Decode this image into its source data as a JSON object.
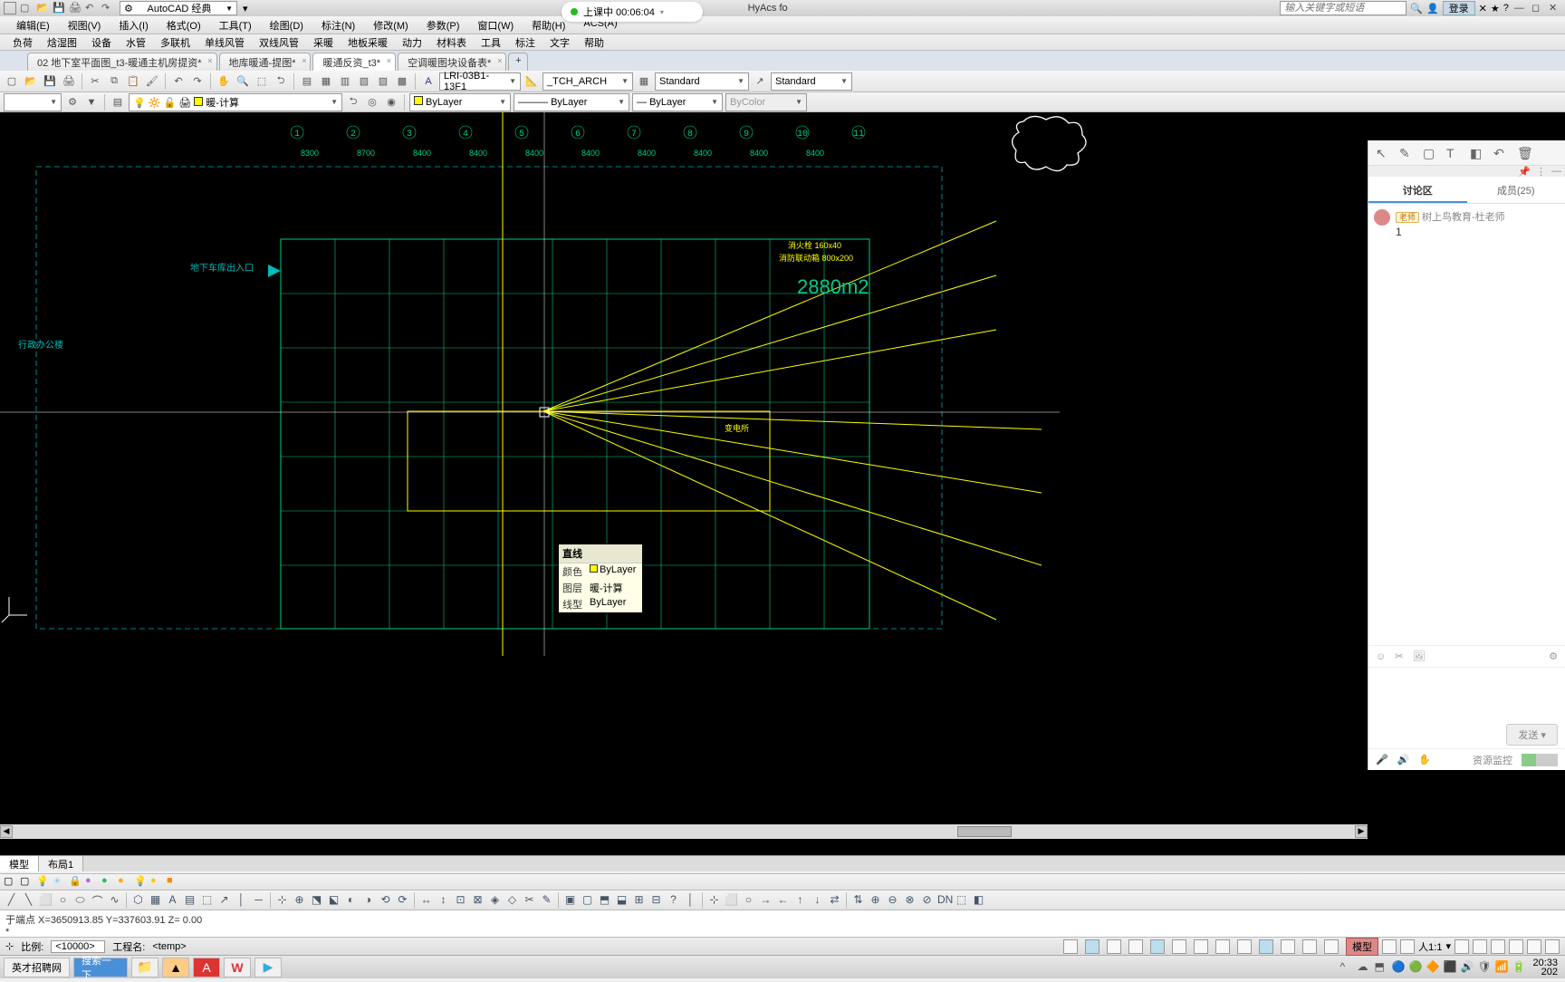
{
  "titlebar": {
    "workspace": "AutoCAD 经典",
    "center_title": "HyAcs fo",
    "search_placeholder": "输入关键字或短语",
    "login": "登录"
  },
  "recording": {
    "label": "上课中 00:06:04"
  },
  "menu": [
    "编辑(E)",
    "视图(V)",
    "插入(I)",
    "格式(O)",
    "工具(T)",
    "绘图(D)",
    "标注(N)",
    "修改(M)",
    "参数(P)",
    "窗口(W)",
    "帮助(H)",
    "ACS(A)"
  ],
  "menu2": [
    "负荷",
    "焓湿图",
    "设备",
    "水管",
    "多联机",
    "单线风管",
    "双线风管",
    "采暖",
    "地板采暖",
    "动力",
    "材料表",
    "工具",
    "标注",
    "文字",
    "帮助"
  ],
  "file_tabs": [
    {
      "label": "02 地下室平面图_t3-暖通主机房提资*",
      "active": false
    },
    {
      "label": "地库暖通-提图*",
      "active": false
    },
    {
      "label": "暖通反资_t3*",
      "active": true
    },
    {
      "label": "空调暖图块设备表*",
      "active": false
    }
  ],
  "toolbar1": {
    "textstyle": "LRI-03B1-13F1",
    "dimstyle": "_TCH_ARCH",
    "tablestyle": "Standard",
    "mleaderstyle": "Standard"
  },
  "toolbar2": {
    "layer_current": "暖-计算",
    "color": "ByLayer",
    "ltype": "ByLayer",
    "lweight": "ByLayer",
    "plot": "ByColor"
  },
  "tooltip": {
    "title": "直线",
    "rows": [
      {
        "k": "颜色",
        "v": "ByLayer",
        "swatch": true
      },
      {
        "k": "图层",
        "v": "暖-计算",
        "swatch": false
      },
      {
        "k": "线型",
        "v": "ByLayer",
        "swatch": false
      }
    ]
  },
  "drawing": {
    "area_label": "2880m2",
    "entry_label": "地下车库出入口",
    "office_label": "行政办公楼",
    "grid_nums": [
      "1",
      "2",
      "3",
      "4",
      "5",
      "6",
      "7",
      "8",
      "9",
      "10",
      "11"
    ],
    "grid_dims": [
      "8300",
      "8700",
      "8400",
      "8400",
      "8400",
      "8400",
      "8400",
      "8400",
      "8400",
      "8400"
    ],
    "yellow_notes": [
      "消火栓 160x40",
      "消防联动箱 800x200",
      "变电所"
    ]
  },
  "chat": {
    "tab_discuss": "讨论区",
    "tab_members": "成员(25)",
    "teacher_tag": "老师",
    "teacher_name": "树上鸟教育-杜老师",
    "msg": "1",
    "send": "发送",
    "res_label": "资源监控"
  },
  "mltabs": [
    "模型",
    "布局1"
  ],
  "cmd": {
    "line1": "于端点  X=3650913.85  Y=337603.91  Z=    0.00",
    "line2": "*"
  },
  "status": {
    "scale_lbl": "比例:",
    "scale": "<10000>",
    "proj_lbl": "工程名:",
    "proj": "<temp>",
    "mode": "模型",
    "annoscale": "人1:1"
  },
  "taskbar": {
    "label": "英才招聘网",
    "search": "搜索一下",
    "time": "20:33",
    "date": "202"
  }
}
